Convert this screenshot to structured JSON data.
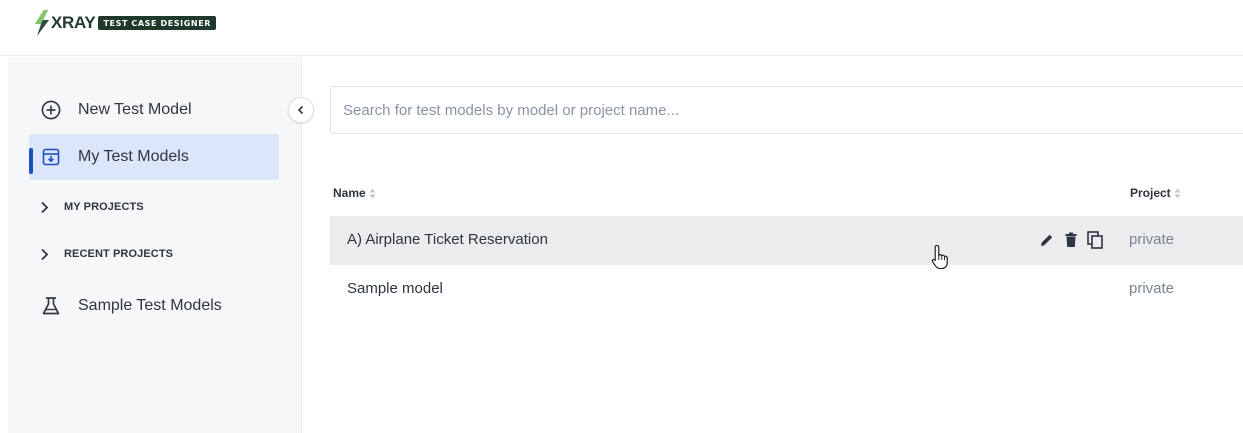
{
  "header": {
    "logo_text": "XRAY",
    "logo_badge": "TEST CASE DESIGNER"
  },
  "sidebar": {
    "items": [
      {
        "label": "New Test Model",
        "icon": "plus-circle-icon"
      },
      {
        "label": "My Test Models",
        "icon": "archive-box-icon",
        "active": true
      },
      {
        "label": "Sample Test Models",
        "icon": "flask-icon"
      }
    ],
    "sections": [
      {
        "label": "MY PROJECTS",
        "icon": "chevron-right-icon"
      },
      {
        "label": "RECENT PROJECTS",
        "icon": "chevron-right-icon"
      }
    ],
    "collapse_icon": "chevron-left-icon"
  },
  "search": {
    "placeholder": "Search for test models by model or project name...",
    "value": ""
  },
  "table": {
    "columns": [
      "Name",
      "Project"
    ],
    "rows": [
      {
        "name": "A) Airplane Ticket Reservation",
        "project": "private",
        "hovered": true,
        "actions": [
          "edit-icon",
          "delete-icon",
          "copy-icon"
        ]
      },
      {
        "name": "Sample model",
        "project": "private",
        "hovered": false
      }
    ]
  },
  "colors": {
    "accent": "#1d4fbf",
    "active_bg": "#dbe6fa",
    "sidebar_bg": "#f6f7f9",
    "row_hover": "#ececef",
    "brand_dark": "#1f3a2b"
  }
}
